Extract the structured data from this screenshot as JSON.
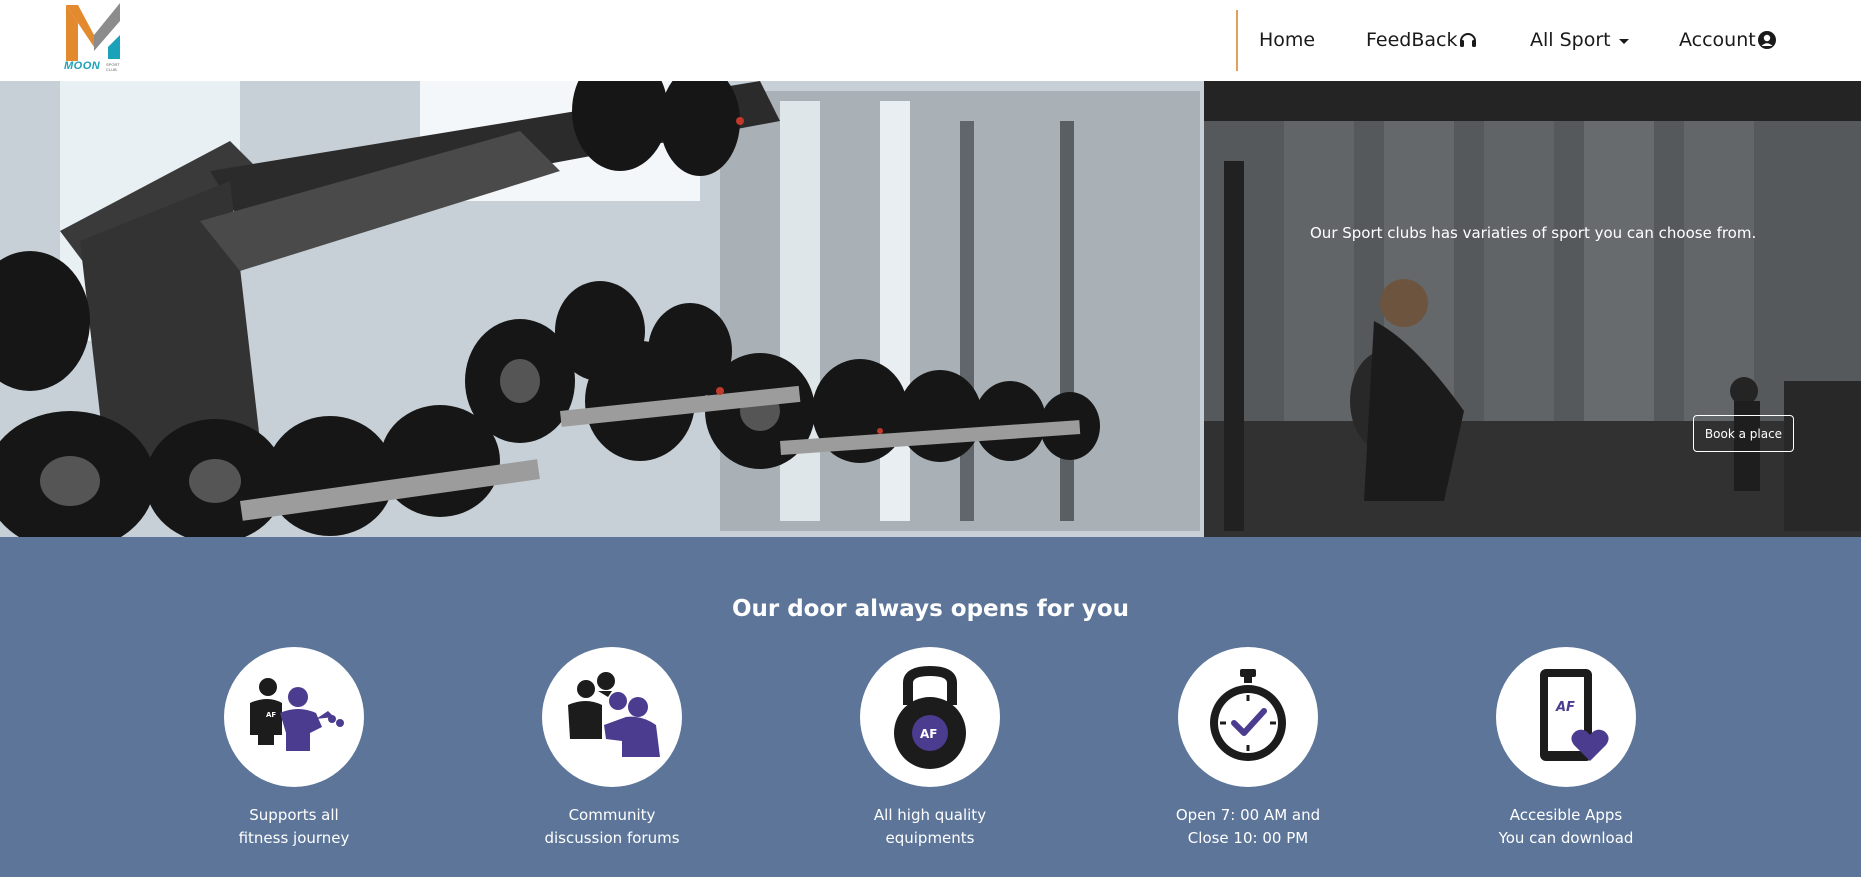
{
  "brand": {
    "logo_name": "MOON",
    "logo_sub": "SPORT CLUB",
    "colors": {
      "orange": "#e38a2f",
      "gray": "#8c8c8c",
      "teal": "#1aa3b8"
    }
  },
  "nav": {
    "home": "Home",
    "feedback": "FeedBack",
    "all_sport": "All Sport",
    "account": "Account",
    "divider_color": "#e2a15b"
  },
  "hero": {
    "caption": "Our Sport clubs has variaties of sport you can choose from.",
    "book_button": "Book a place"
  },
  "features": {
    "title": "Our door always opens for you",
    "bg_color": "#5c7599",
    "accent_color": "#4b3c8f",
    "items": [
      {
        "icon": "supporters-icon",
        "line1": "Supports all",
        "line2": "fitness journey"
      },
      {
        "icon": "community-icon",
        "line1": "Community",
        "line2": "discussion forums"
      },
      {
        "icon": "kettlebell-icon",
        "line1": "All high quality",
        "line2": "equipments"
      },
      {
        "icon": "stopwatch-icon",
        "line1": "Open 7: 00 AM and",
        "line2": "Close 10: 00 PM"
      },
      {
        "icon": "phone-heart-icon",
        "line1": "Accesible Apps",
        "line2": "You can download"
      }
    ],
    "badge_text": "AF"
  }
}
